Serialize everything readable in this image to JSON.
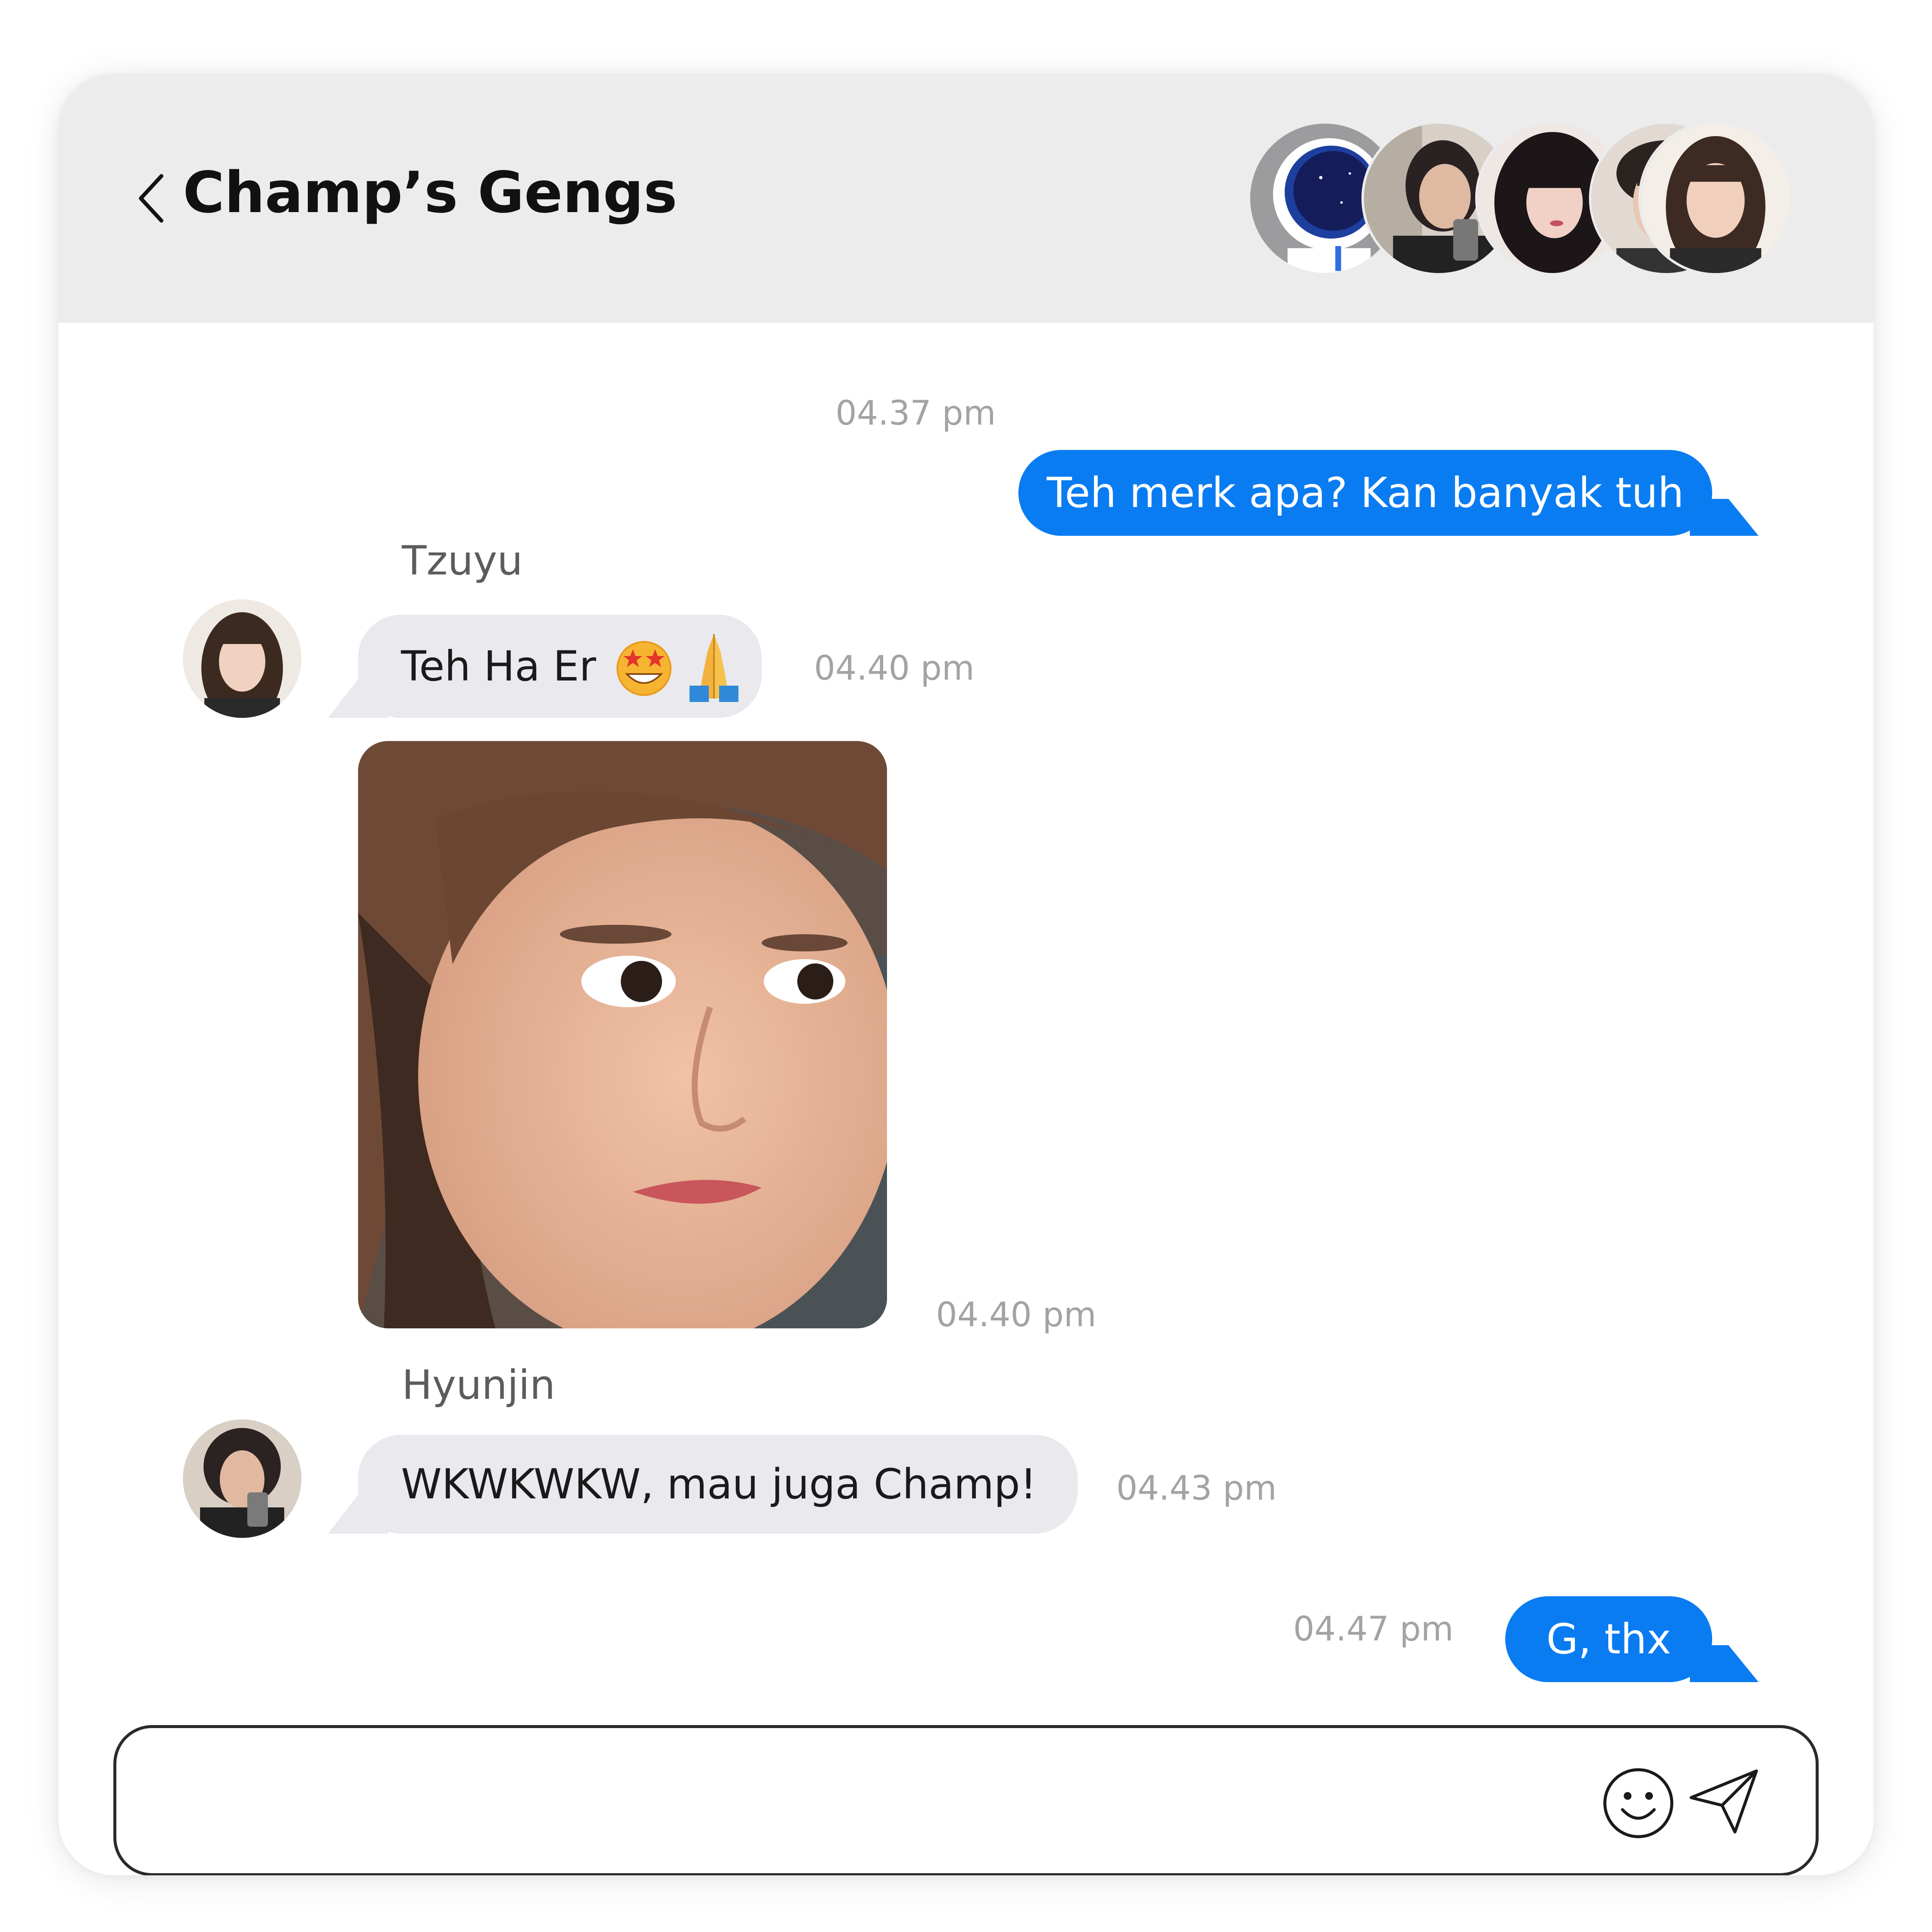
{
  "header": {
    "back_icon": "chevron-left-icon",
    "title": "Champ’s Gengs",
    "member_avatars": [
      "astronaut-avatar",
      "hyunjin-avatar",
      "member-avatar-3",
      "member-avatar-4",
      "tzuyu-avatar"
    ]
  },
  "messages": [
    {
      "direction": "outgoing",
      "text": "Teh merk apa? Kan banyak tuh",
      "time": "04.37 pm"
    },
    {
      "direction": "incoming",
      "sender": "Tzuyu",
      "text": "Teh Ha Er",
      "emojis": [
        "star-struck-emoji",
        "folded-hands-emoji"
      ],
      "time": "04.40 pm"
    },
    {
      "direction": "incoming",
      "sender": "Tzuyu",
      "type": "image",
      "image_desc": "selfie-photo",
      "time": "04.40 pm"
    },
    {
      "direction": "incoming",
      "sender": "Hyunjin",
      "text": "WKWKWKW, mau juga Champ!",
      "time": "04.43 pm"
    },
    {
      "direction": "outgoing",
      "text": "G, thx",
      "time": "04.47 pm"
    }
  ],
  "composer": {
    "placeholder": "",
    "value": "",
    "emoji_icon": "smiley-icon",
    "send_icon": "send-icon"
  },
  "colors": {
    "outgoing_bubble": "#0a7cf2",
    "incoming_bubble": "#e9e9ee",
    "header_bg": "#ececed",
    "timestamp": "#a3a3a6"
  }
}
